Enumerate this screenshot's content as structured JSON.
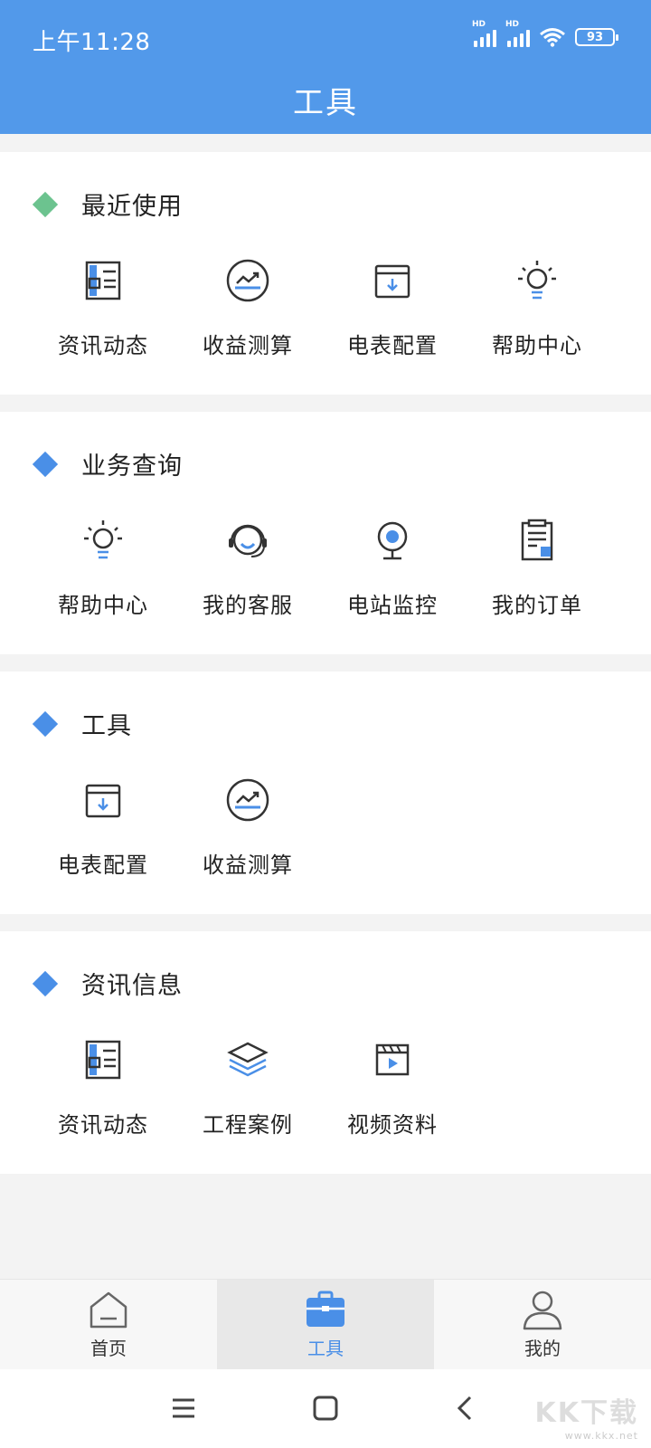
{
  "status_bar": {
    "time": "上午11:28",
    "battery": "93",
    "signal_label": "HD"
  },
  "header": {
    "title": "工具"
  },
  "sections": [
    {
      "title": "最近使用",
      "accent": "#6cc38f",
      "items": [
        {
          "label": "资讯动态",
          "icon": "news-icon"
        },
        {
          "label": "收益测算",
          "icon": "chart-trend-icon"
        },
        {
          "label": "电表配置",
          "icon": "meter-box-icon"
        },
        {
          "label": "帮助中心",
          "icon": "bulb-icon"
        }
      ]
    },
    {
      "title": "业务查询",
      "accent": "#4a8fe7",
      "items": [
        {
          "label": "帮助中心",
          "icon": "bulb-icon"
        },
        {
          "label": "我的客服",
          "icon": "headset-icon"
        },
        {
          "label": "电站监控",
          "icon": "camera-icon"
        },
        {
          "label": "我的订单",
          "icon": "order-icon"
        }
      ]
    },
    {
      "title": "工具",
      "accent": "#4a8fe7",
      "items": [
        {
          "label": "电表配置",
          "icon": "meter-box-icon"
        },
        {
          "label": "收益测算",
          "icon": "chart-trend-icon"
        }
      ]
    },
    {
      "title": "资讯信息",
      "accent": "#4a8fe7",
      "items": [
        {
          "label": "资讯动态",
          "icon": "news-icon"
        },
        {
          "label": "工程案例",
          "icon": "layers-icon"
        },
        {
          "label": "视频资料",
          "icon": "video-icon"
        }
      ]
    }
  ],
  "tabbar": [
    {
      "label": "首页",
      "icon": "home-icon",
      "active": false
    },
    {
      "label": "工具",
      "icon": "toolbox-icon",
      "active": true
    },
    {
      "label": "我的",
      "icon": "user-icon",
      "active": false
    }
  ],
  "watermark": {
    "text": "KK下载",
    "sub": "www.kkx.net"
  },
  "colors": {
    "header": "#5299ea",
    "accent_blue": "#4a8fe7",
    "accent_green": "#6cc38f",
    "icon_stroke": "#333333"
  }
}
